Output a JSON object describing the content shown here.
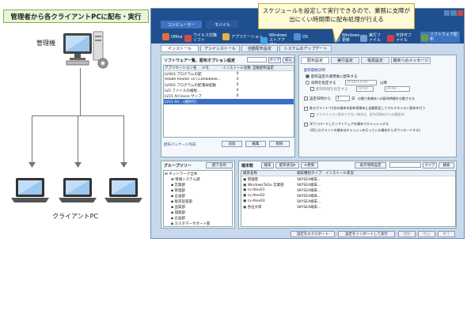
{
  "title_label": "管理者から各クライアントPCに配布・実行",
  "admin_label": "管理機",
  "client_label": "クライアントPC",
  "callout_text": "スケジュールを設定して実行できるので、業務に支障が出にくい時間帯に配布処理が行える",
  "window": {
    "top_tabs": [
      "コンピューター",
      "モバイル"
    ],
    "ribbon_buttons": [
      {
        "label": "Office",
        "color": "#e0703a"
      },
      {
        "label": "ウイルス対策ソフト",
        "color": "#d24b4b"
      },
      {
        "label": "アプリケーション",
        "color": "#e5b440"
      },
      {
        "label": "Windows ストアアプリ",
        "color": "#4aa0e0"
      },
      {
        "label": "OS",
        "color": "#5a8cd8"
      },
      {
        "label": "Windows 更新",
        "color": "#4b7fd0"
      },
      {
        "label": "実行ファイル",
        "color": "#7aa0d8"
      },
      {
        "label": "不許可ファイル",
        "color": "#d04040"
      },
      {
        "label": "ソフトウェア配布",
        "color": "#6a9c48"
      }
    ],
    "sub_tabs": [
      "インストール",
      "アンインストール",
      "自動配布設定",
      "システムのアップデート"
    ],
    "list_panel": {
      "title": "ソフトウェア一覧、配布オプション設定",
      "search_btn": "クリア",
      "filter_btn": "絞込",
      "headers": [
        "アプリケーション名",
        "メモ",
        "インストール台数",
        "自動配布設定"
      ],
      "rows": [
        [
          "LV403 プログラムの配...",
          "",
          "0",
          ""
        ],
        [
          "Adobe Reader 10 (1110...",
          "AdobeRe...",
          "0",
          ""
        ],
        [
          "LV403 プログラムの配...",
          "電卓起動",
          "0",
          ""
        ],
        [
          "LV2 ファイルの複製...",
          "",
          "0",
          ""
        ],
        [
          "LV21 All Users サンプ...",
          "",
          "0",
          ""
        ],
        [
          "LV21 All ...(選択行)",
          "",
          "",
          ""
        ]
      ],
      "bottom_left": "配布パッケージ作成",
      "btn_add": "追加",
      "btn_edit": "編集",
      "btn_delete": "削除"
    },
    "settings_panel": {
      "tabs": [
        "配布設定",
        "実行設定",
        "電源設定",
        "端末へのメッセージ"
      ],
      "group_title": "配布開始日時",
      "opt1": "配布設定の適用後に配布する",
      "opt2": "日時を指定する",
      "date_value": "2018/12/28",
      "time_value": "10:42",
      "after_label": "以降",
      "end_date": "2018/...",
      "chk_spec": "配布時間を指定する",
      "chk_range": "設定日時から",
      "range_value": "1",
      "range_unit": "日",
      "range_tail": "の間で各端末への配布時間を分散させる",
      "chk_multicast": "各セグメントで1台の端末を配布用端末に自動設定してマルチキャスト配布を行う",
      "chk_multicast_sub": "マルチキャスト配布できない端末は、配布用端末から自動配布",
      "chk_cache": "ダウンロードしたソフトウェアを端末でキャッシュする",
      "chk_cache_sub": "(同じセグメントの端末はキャッシュを行っている端末からダウンロードする)"
    },
    "group_tree": {
      "title": "グループツリー",
      "btn": "配下含有",
      "items": [
        "ネットワーク全体",
        "情報システム部",
        "営業部",
        "管理部",
        "企画部",
        "販売促進部",
        "品質部",
        "開発部",
        "企画部",
        "カスタマーサポート部",
        "生産部"
      ]
    },
    "terminal": {
      "tabs": [
        "端末数",
        "端末",
        "配布状況"
      ],
      "btn_update": "更新",
      "btn_display": "表示項目設定",
      "btn_clear": "クリア",
      "btn_search": "検索",
      "headers": [
        "端末名称",
        "端末種別タイプ",
        "インストール状況"
      ],
      "rows": [
        [
          "管理者",
          "SKYSEA端末..."
        ],
        [
          "WindowsToGo 営業部",
          "SKYSEA端末..."
        ],
        [
          "cv-Alex01",
          "SKYSEA端末..."
        ],
        [
          "cv-Alex02",
          "SKYSEA端末..."
        ],
        [
          "cv-Alex03",
          "SKYSEA端末..."
        ],
        [
          "各位大郎",
          "SKYSEA端末..."
        ]
      ]
    },
    "bottom_buttons": [
      "設定をエクスポート",
      "設定をインポートして実行",
      "開始",
      "停止",
      "終了"
    ]
  }
}
